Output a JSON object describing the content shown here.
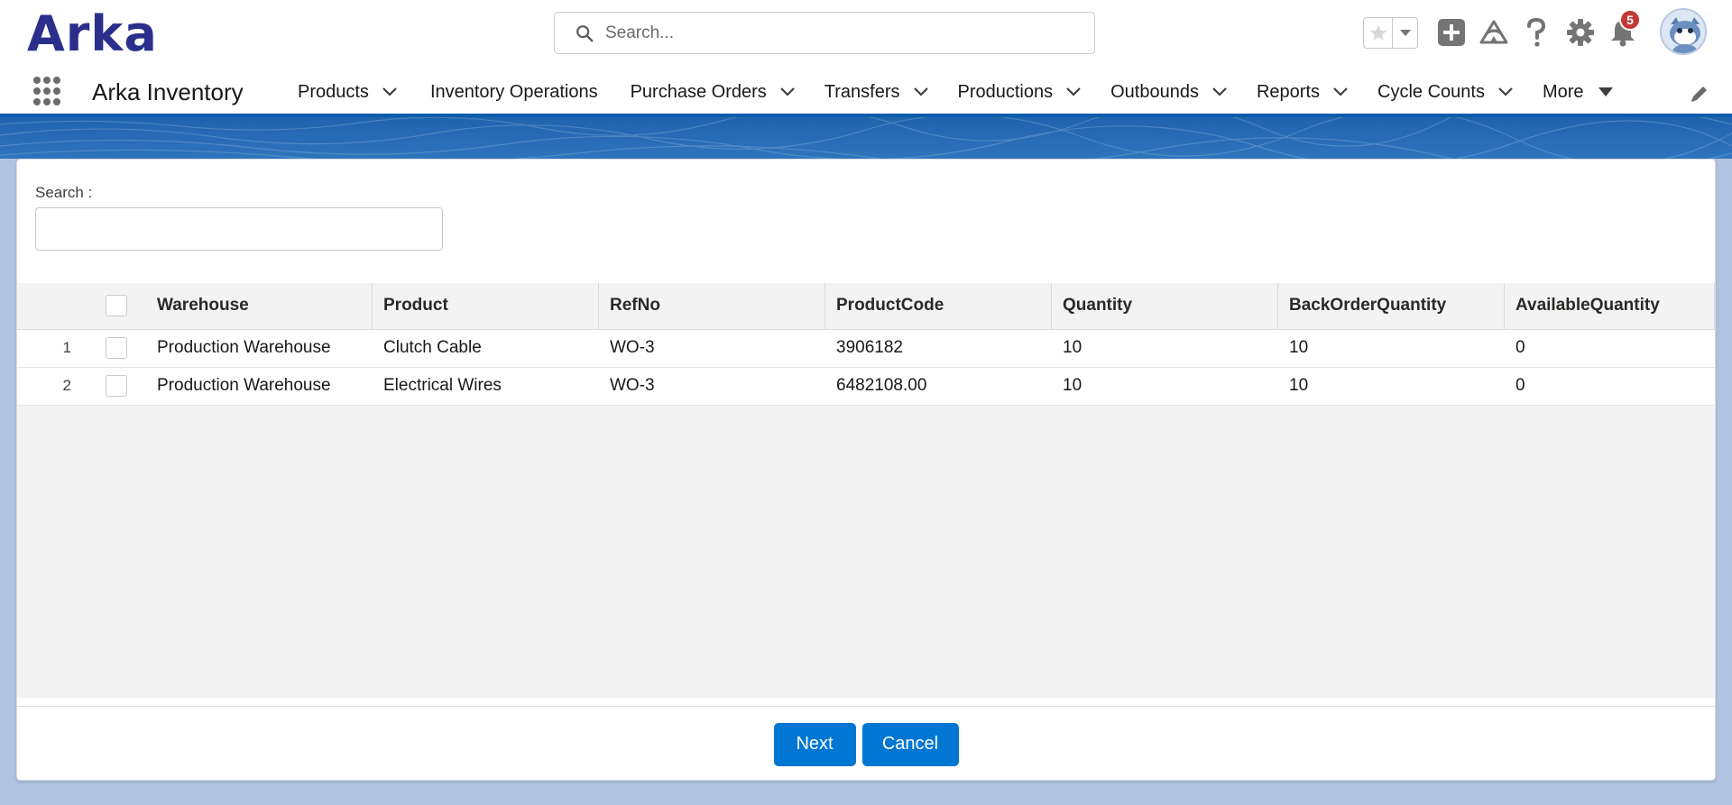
{
  "header": {
    "logo_text": "Arka",
    "search_placeholder": "Search...",
    "notification_count": "5",
    "icons": [
      "search-icon",
      "star-icon",
      "chevron-down-icon",
      "add-icon",
      "trailhead-icon",
      "help-icon",
      "gear-icon",
      "bell-icon",
      "avatar"
    ]
  },
  "nav": {
    "app_name": "Arka Inventory",
    "items": [
      {
        "label": "Products",
        "has_dropdown": true
      },
      {
        "label": "Inventory Operations",
        "has_dropdown": false
      },
      {
        "label": "Purchase Orders",
        "has_dropdown": true
      },
      {
        "label": "Transfers",
        "has_dropdown": true
      },
      {
        "label": "Productions",
        "has_dropdown": true
      },
      {
        "label": "Outbounds",
        "has_dropdown": true
      },
      {
        "label": "Reports",
        "has_dropdown": true
      },
      {
        "label": "Cycle Counts",
        "has_dropdown": true
      },
      {
        "label": "More",
        "has_dropdown": true
      }
    ]
  },
  "main": {
    "search_label": "Search :",
    "search_value": "",
    "table": {
      "columns": [
        "Warehouse",
        "Product",
        "RefNo",
        "ProductCode",
        "Quantity",
        "BackOrderQuantity",
        "AvailableQuantity"
      ],
      "rows": [
        {
          "num": "1",
          "warehouse": "Production Warehouse",
          "product": "Clutch Cable",
          "refno": "WO-3",
          "productcode": "3906182",
          "quantity": "10",
          "backorder": "10",
          "available": "0"
        },
        {
          "num": "2",
          "warehouse": "Production Warehouse",
          "product": "Electrical Wires",
          "refno": "WO-3",
          "productcode": "6482108.00",
          "quantity": "10",
          "backorder": "10",
          "available": "0"
        }
      ]
    },
    "buttons": {
      "next": "Next",
      "cancel": "Cancel"
    }
  },
  "colors": {
    "brand_blue": "#0176d3",
    "logo": "#2a2f8c",
    "nav_border": "#0b5cab",
    "badge": "#c23934",
    "background": "#b0c4df"
  }
}
